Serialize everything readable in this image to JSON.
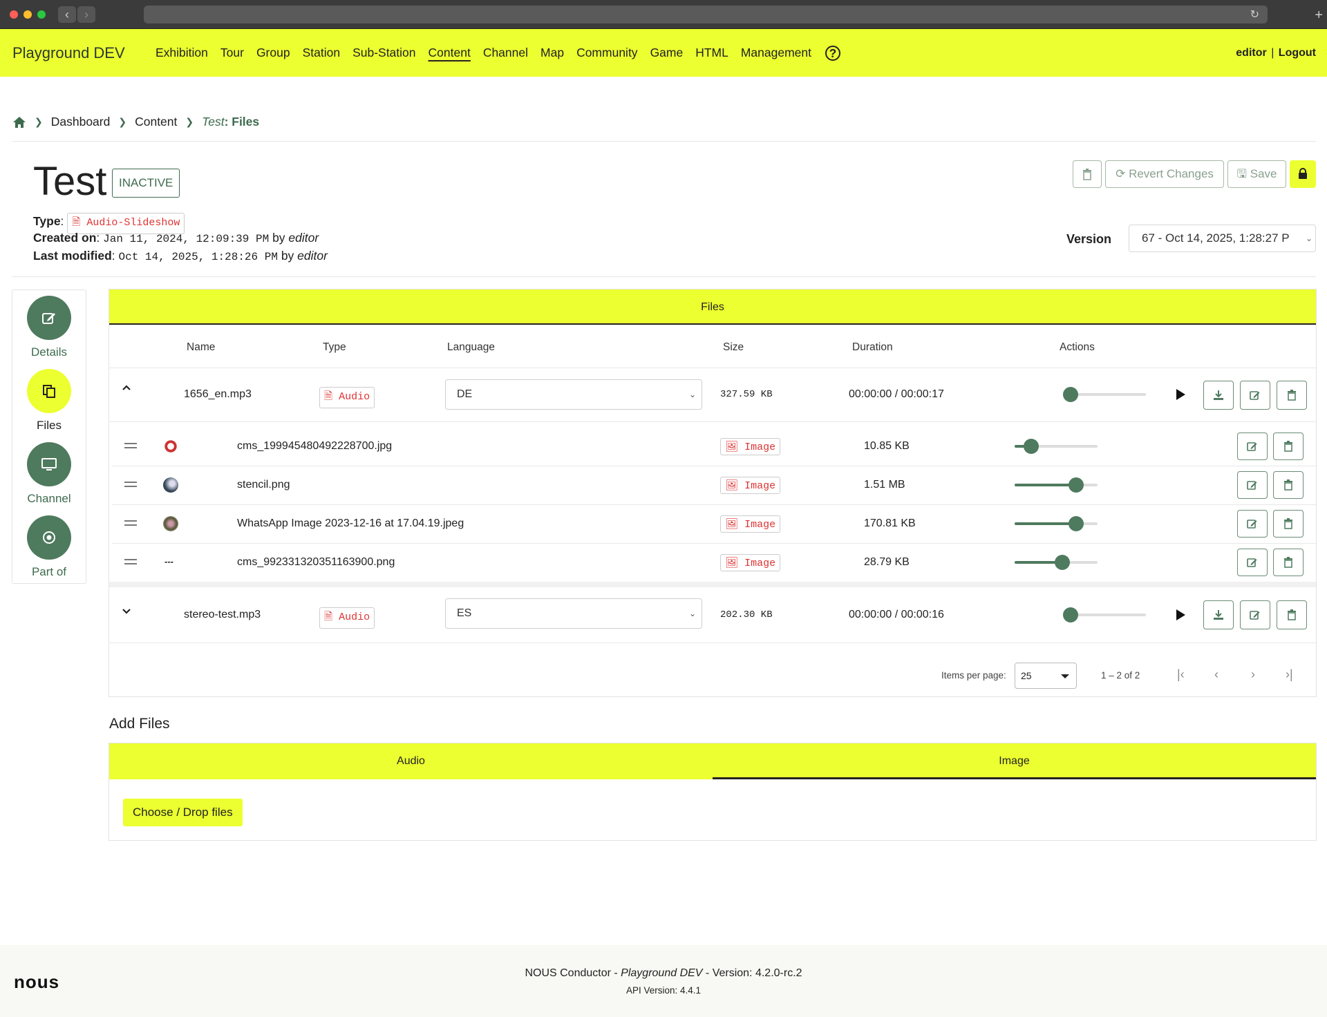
{
  "header": {
    "brand": "Playground DEV",
    "nav": [
      {
        "label": "Exhibition"
      },
      {
        "label": "Tour"
      },
      {
        "label": "Group"
      },
      {
        "label": "Station"
      },
      {
        "label": "Sub-Station"
      },
      {
        "label": "Content",
        "active": true
      },
      {
        "label": "Channel"
      },
      {
        "label": "Map"
      },
      {
        "label": "Community"
      },
      {
        "label": "Game"
      },
      {
        "label": "HTML"
      },
      {
        "label": "Management"
      }
    ],
    "help": "?",
    "user": "editor",
    "separator": "|",
    "logout": "Logout"
  },
  "breadcrumb": {
    "items": [
      "Dashboard",
      "Content"
    ],
    "current_prefix": "Test",
    "current_suffix": ": Files"
  },
  "page": {
    "title": "Test",
    "status": "INACTIVE",
    "type_label": "Type",
    "type_value": "Audio-Slideshow",
    "created_label": "Created on",
    "created_value": "Jan 11, 2024, 12:09:39 PM",
    "created_by": "by",
    "created_user": "editor",
    "modified_label": "Last modified",
    "modified_value": "Oct 14, 2025, 1:28:26 PM",
    "modified_by": "by",
    "modified_user": "editor"
  },
  "toolbar": {
    "revert_label": "Revert Changes",
    "save_label": "Save"
  },
  "version": {
    "label": "Version",
    "value": "67 - Oct 14, 2025, 1:28:27 P"
  },
  "sidenav": {
    "items": [
      {
        "label": "Details",
        "icon": "edit-icon"
      },
      {
        "label": "Files",
        "icon": "files-icon",
        "active": true
      },
      {
        "label": "Channel",
        "icon": "monitor-icon"
      },
      {
        "label": "Part of",
        "icon": "target-icon"
      }
    ]
  },
  "files": {
    "panel_title": "Files",
    "columns": {
      "name": "Name",
      "type": "Type",
      "language": "Language",
      "size": "Size",
      "duration": "Duration",
      "actions": "Actions"
    },
    "audio": [
      {
        "name": "1656_en.mp3",
        "type": "Audio",
        "language": "DE",
        "size": "327.59 KB",
        "duration": "00:00:00 / 00:00:17",
        "progress": 0,
        "expanded": true,
        "images": [
          {
            "name": "cms_199945480492228700.jpg",
            "type": "Image",
            "size": "10.85 KB",
            "position": 0.13
          },
          {
            "name": "stencil.png",
            "type": "Image",
            "size": "1.51 MB",
            "position": 0.8
          },
          {
            "name": "WhatsApp Image 2023-12-16 at 17.04.19.jpeg",
            "type": "Image",
            "size": "170.81 KB",
            "position": 0.8
          },
          {
            "name": "cms_992331320351163900.png",
            "type": "Image",
            "size": "28.79 KB",
            "position": 0.59,
            "thumb_text": "---"
          }
        ]
      },
      {
        "name": "stereo-test.mp3",
        "type": "Audio",
        "language": "ES",
        "size": "202.30 KB",
        "duration": "00:00:00 / 00:00:16",
        "progress": 0,
        "expanded": false
      }
    ],
    "paginator": {
      "items_per_page_label": "Items per page:",
      "items_per_page": "25",
      "range": "1 – 2 of 2"
    }
  },
  "add_files": {
    "title": "Add Files",
    "tabs": [
      "Audio",
      "Image"
    ],
    "active_tab": "Image",
    "choose_label": "Choose / Drop files"
  },
  "footer": {
    "logo": "nous",
    "app": "NOUS Conductor",
    "dash": " - ",
    "instance": "Playground DEV",
    "version": " - Version: 4.2.0-rc.2",
    "api": "API Version: 4.4.1"
  },
  "colors": {
    "accent": "#ecff30",
    "primary": "#4e7a5e",
    "badge": "#dd3333"
  }
}
